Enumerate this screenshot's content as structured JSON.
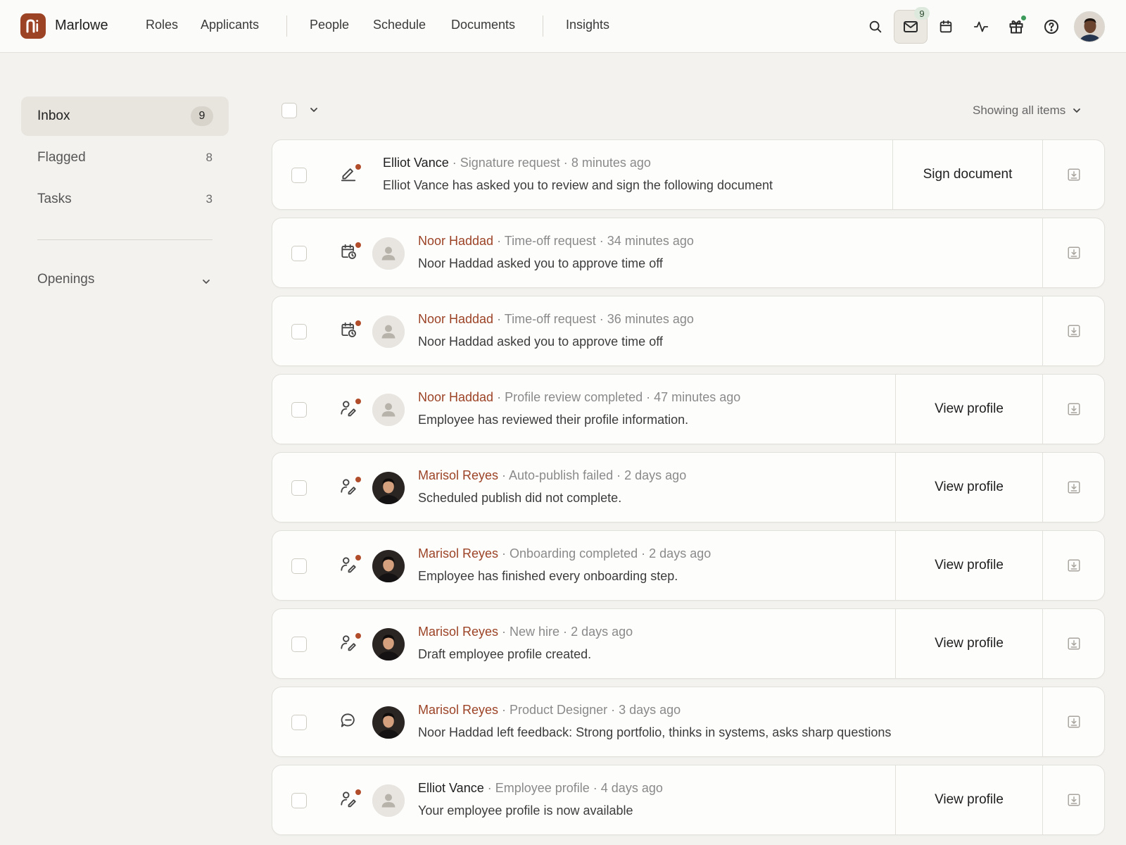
{
  "app": {
    "name": "Marlowe"
  },
  "nav": {
    "roles": "Roles",
    "applicants": "Applicants",
    "people": "People",
    "schedule": "Schedule",
    "documents": "Documents",
    "insights": "Insights"
  },
  "header": {
    "mail_count": "9",
    "accent": "#9c4326"
  },
  "sidebar": {
    "inbox": {
      "label": "Inbox",
      "count": "9"
    },
    "flagged": {
      "label": "Flagged",
      "count": "8"
    },
    "tasks": {
      "label": "Tasks",
      "count": "3"
    },
    "openings": "Openings"
  },
  "toolbar": {
    "filter": "Showing all items"
  },
  "rows": [
    {
      "icon": "pen-icon",
      "avatar": "none",
      "name": "Elliot Vance",
      "type": "· Signature request ·",
      "time": "8 minutes ago",
      "message": "Elliot Vance has asked you to review and sign the following document",
      "action": "Sign document"
    },
    {
      "icon": "calendar-clock-icon",
      "avatar": "placeholder",
      "name": "Noor Haddad",
      "type": "· Time-off request ·",
      "time": "34 minutes ago",
      "message": "Noor Haddad asked you to approve time off",
      "action": ""
    },
    {
      "icon": "calendar-clock-icon",
      "avatar": "placeholder",
      "name": "Noor Haddad",
      "type": "· Time-off request ·",
      "time": "36 minutes ago",
      "message": "Noor Haddad asked you to approve time off",
      "action": ""
    },
    {
      "icon": "user-edit-icon",
      "avatar": "placeholder",
      "name": "Noor Haddad",
      "type": "· Profile review completed ·",
      "time": "47 minutes ago",
      "message": "Employee has reviewed their profile information.",
      "action": "View profile"
    },
    {
      "icon": "user-edit-icon",
      "avatar": "photo",
      "name": "Marisol Reyes",
      "type": "· Auto-publish failed ·",
      "time": "2 days ago",
      "message": "Scheduled publish did not complete.",
      "action": "View profile"
    },
    {
      "icon": "user-edit-icon",
      "avatar": "photo",
      "name": "Marisol Reyes",
      "type": "· Onboarding completed ·",
      "time": "2 days ago",
      "message": "Employee has finished every onboarding step.",
      "action": "View profile"
    },
    {
      "icon": "user-edit-icon",
      "avatar": "photo",
      "name": "Marisol Reyes",
      "type": "· New hire ·",
      "time": "2 days ago",
      "message": "Draft employee profile created.",
      "action": "View profile"
    },
    {
      "icon": "chat-icon",
      "avatar": "photo",
      "name": "Marisol Reyes",
      "type": "· Product Designer ·",
      "time": "3 days ago",
      "message": "Noor Haddad left feedback: Strong portfolio, thinks in systems, asks sharp questions",
      "action": ""
    },
    {
      "icon": "user-edit-icon",
      "avatar": "placeholder",
      "name": "Elliot Vance",
      "type": "· Employee profile ·",
      "time": "4 days ago",
      "message": "Your employee profile is now available",
      "action": "View profile"
    }
  ]
}
